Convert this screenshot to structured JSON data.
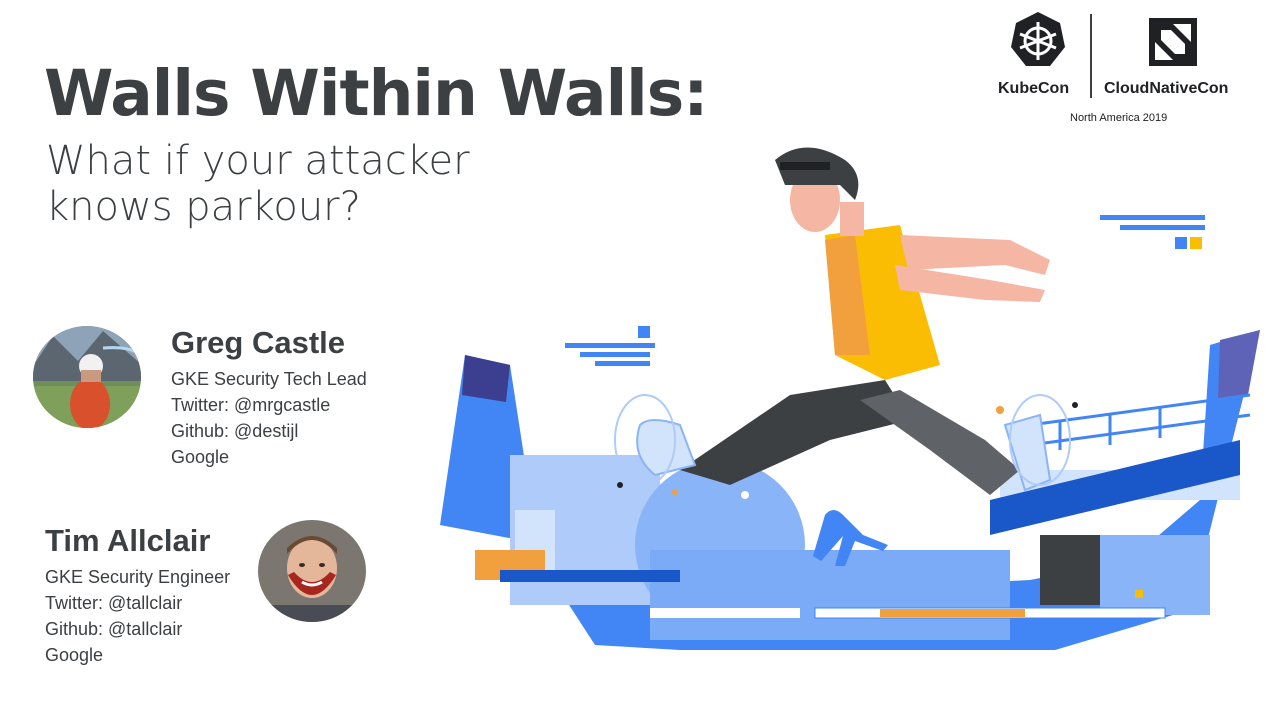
{
  "title": "Walls Within Walls:",
  "subtitle": "What if your attacker\nknows parkour?",
  "speakers": [
    {
      "name": "Greg Castle",
      "role": "GKE Security Tech Lead",
      "twitter": "Twitter: @mrgcastle",
      "github": "Github: @destijl",
      "company": "Google"
    },
    {
      "name": "Tim Allclair",
      "role": "GKE Security Engineer",
      "twitter": "Twitter: @tallclair",
      "github": "Github: @tallclair",
      "company": "Google"
    }
  ],
  "event_logo": {
    "left_text": "KubeCon",
    "right_text": "CloudNativeCon",
    "sub_text": "North America 2019",
    "left_icon": "kubernetes-helm-icon",
    "right_icon": "cncf-icon"
  },
  "illustration": {
    "subject": "parkour-runner-illustration",
    "colors": {
      "blue": "#4285f4",
      "dark_blue": "#1a57c9",
      "light_blue": "#aecbfa",
      "yellow": "#fbbc04",
      "orange": "#f29f3d",
      "dark": "#3c4043",
      "skin": "#f6b6a4"
    }
  },
  "colors": {
    "text": "#3c4043",
    "background": "#ffffff"
  }
}
